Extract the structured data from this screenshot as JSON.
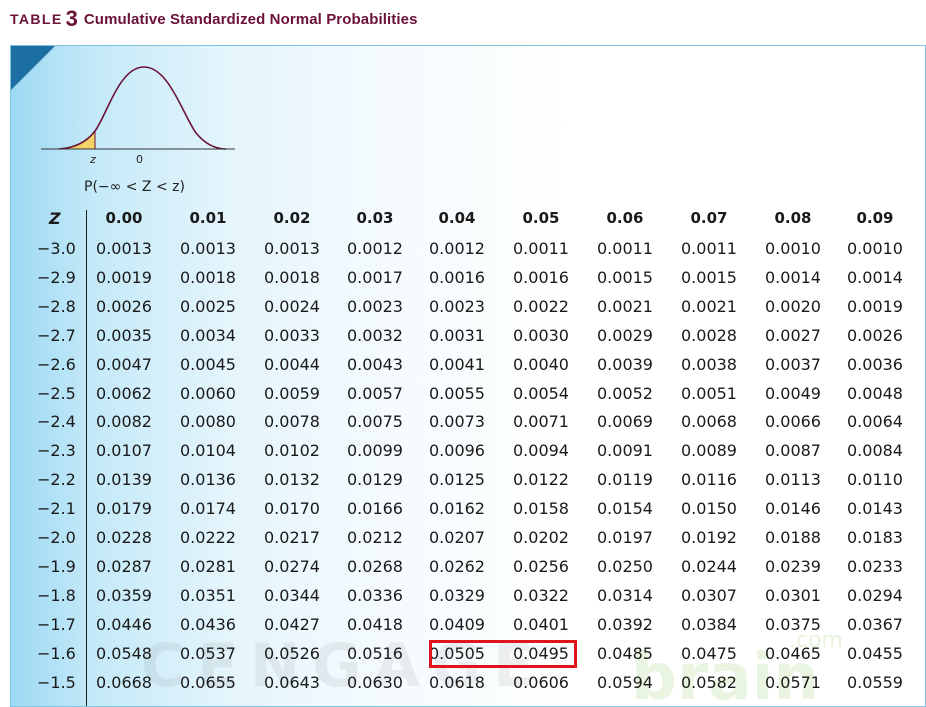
{
  "title": {
    "table_word": "TABLE",
    "table_number": "3",
    "description": "Cumulative Standardized Normal Probabilities"
  },
  "figure": {
    "z_label": "z",
    "zero_label": "0",
    "probability_label": "P(−∞ < Z < z)",
    "shaded_color": "#f2d46a"
  },
  "table": {
    "z_header": "Z",
    "columns": [
      "0.00",
      "0.01",
      "0.02",
      "0.03",
      "0.04",
      "0.05",
      "0.06",
      "0.07",
      "0.08",
      "0.09"
    ],
    "rows": [
      {
        "z": "−3.0",
        "values": [
          "0.0013",
          "0.0013",
          "0.0013",
          "0.0012",
          "0.0012",
          "0.0011",
          "0.0011",
          "0.0011",
          "0.0010",
          "0.0010"
        ]
      },
      {
        "z": "−2.9",
        "values": [
          "0.0019",
          "0.0018",
          "0.0018",
          "0.0017",
          "0.0016",
          "0.0016",
          "0.0015",
          "0.0015",
          "0.0014",
          "0.0014"
        ]
      },
      {
        "z": "−2.8",
        "values": [
          "0.0026",
          "0.0025",
          "0.0024",
          "0.0023",
          "0.0023",
          "0.0022",
          "0.0021",
          "0.0021",
          "0.0020",
          "0.0019"
        ]
      },
      {
        "z": "−2.7",
        "values": [
          "0.0035",
          "0.0034",
          "0.0033",
          "0.0032",
          "0.0031",
          "0.0030",
          "0.0029",
          "0.0028",
          "0.0027",
          "0.0026"
        ]
      },
      {
        "z": "−2.6",
        "values": [
          "0.0047",
          "0.0045",
          "0.0044",
          "0.0043",
          "0.0041",
          "0.0040",
          "0.0039",
          "0.0038",
          "0.0037",
          "0.0036"
        ]
      },
      {
        "z": "−2.5",
        "values": [
          "0.0062",
          "0.0060",
          "0.0059",
          "0.0057",
          "0.0055",
          "0.0054",
          "0.0052",
          "0.0051",
          "0.0049",
          "0.0048"
        ]
      },
      {
        "z": "−2.4",
        "values": [
          "0.0082",
          "0.0080",
          "0.0078",
          "0.0075",
          "0.0073",
          "0.0071",
          "0.0069",
          "0.0068",
          "0.0066",
          "0.0064"
        ]
      },
      {
        "z": "−2.3",
        "values": [
          "0.0107",
          "0.0104",
          "0.0102",
          "0.0099",
          "0.0096",
          "0.0094",
          "0.0091",
          "0.0089",
          "0.0087",
          "0.0084"
        ]
      },
      {
        "z": "−2.2",
        "values": [
          "0.0139",
          "0.0136",
          "0.0132",
          "0.0129",
          "0.0125",
          "0.0122",
          "0.0119",
          "0.0116",
          "0.0113",
          "0.0110"
        ]
      },
      {
        "z": "−2.1",
        "values": [
          "0.0179",
          "0.0174",
          "0.0170",
          "0.0166",
          "0.0162",
          "0.0158",
          "0.0154",
          "0.0150",
          "0.0146",
          "0.0143"
        ]
      },
      {
        "z": "−2.0",
        "values": [
          "0.0228",
          "0.0222",
          "0.0217",
          "0.0212",
          "0.0207",
          "0.0202",
          "0.0197",
          "0.0192",
          "0.0188",
          "0.0183"
        ]
      },
      {
        "z": "−1.9",
        "values": [
          "0.0287",
          "0.0281",
          "0.0274",
          "0.0268",
          "0.0262",
          "0.0256",
          "0.0250",
          "0.0244",
          "0.0239",
          "0.0233"
        ]
      },
      {
        "z": "−1.8",
        "values": [
          "0.0359",
          "0.0351",
          "0.0344",
          "0.0336",
          "0.0329",
          "0.0322",
          "0.0314",
          "0.0307",
          "0.0301",
          "0.0294"
        ]
      },
      {
        "z": "−1.7",
        "values": [
          "0.0446",
          "0.0436",
          "0.0427",
          "0.0418",
          "0.0409",
          "0.0401",
          "0.0392",
          "0.0384",
          "0.0375",
          "0.0367"
        ]
      },
      {
        "z": "−1.6",
        "values": [
          "0.0548",
          "0.0537",
          "0.0526",
          "0.0516",
          "0.0505",
          "0.0495",
          "0.0485",
          "0.0475",
          "0.0465",
          "0.0455"
        ]
      },
      {
        "z": "−1.5",
        "values": [
          "0.0668",
          "0.0655",
          "0.0643",
          "0.0630",
          "0.0618",
          "0.0606",
          "0.0594",
          "0.0582",
          "0.0571",
          "0.0559"
        ]
      }
    ]
  },
  "highlight": {
    "row_z": "−1.6",
    "columns": [
      "0.04",
      "0.05"
    ],
    "color": "#e0151b"
  },
  "watermark": {
    "text_left": "CENGAGE",
    "text_right": "brain",
    "text_suffix": ".com"
  }
}
